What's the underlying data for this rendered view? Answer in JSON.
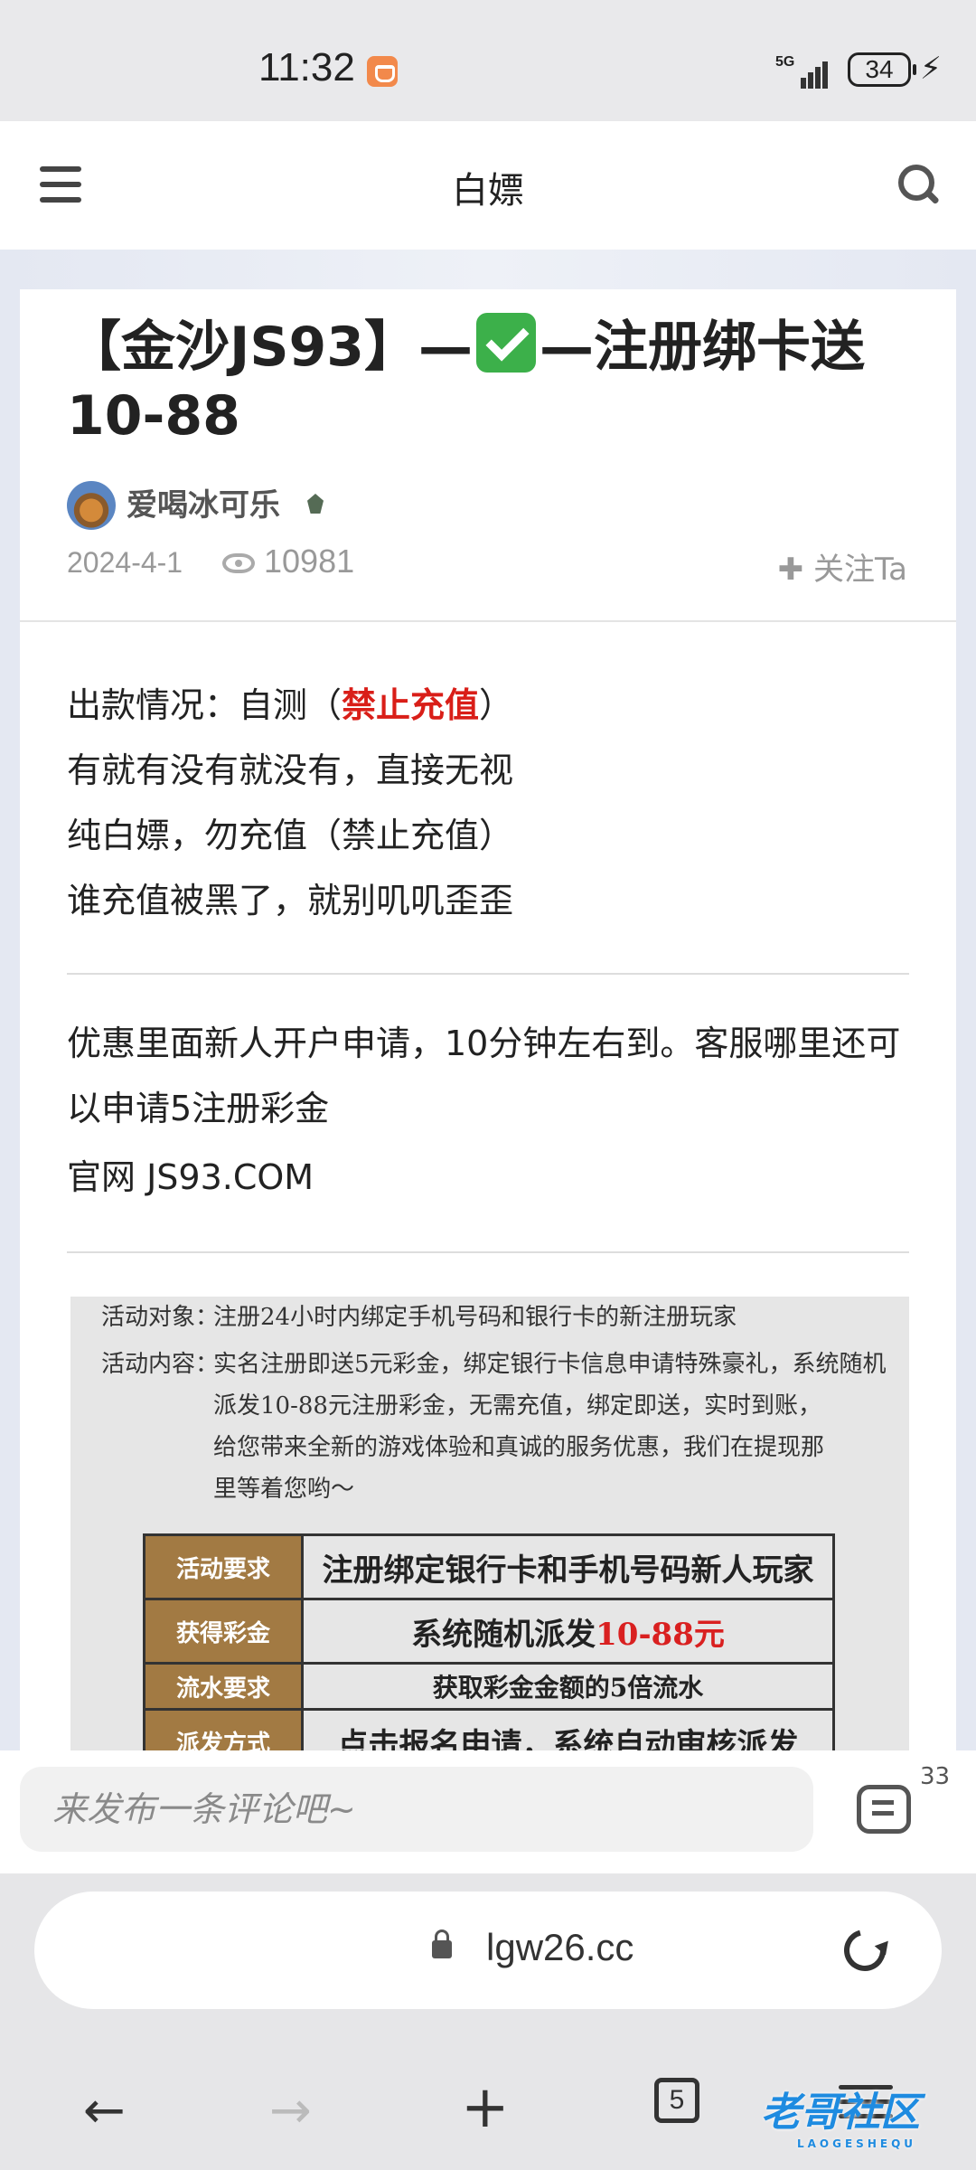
{
  "status_bar": {
    "time": "11:32",
    "network": "5G",
    "battery": "34"
  },
  "app_bar": {
    "title": "白嫖"
  },
  "post": {
    "title_part1": "【金沙JS93】—",
    "title_part2": "—注册绑卡送10-88",
    "author": "爱喝冰可乐",
    "date": "2024-4-1",
    "views": "10981",
    "follow_label": "关注Ta",
    "line1_prefix": "出款情况：自测（",
    "line1_red": "禁止充值",
    "line1_suffix": "）",
    "line2": "有就有没有就没有，直接无视",
    "line3": "纯白嫖，勿充值（禁止充值）",
    "line4": "谁充值被黑了，就别叽叽歪歪",
    "para2": "优惠里面新人开户申请，10分钟左右到。客服哪里还可以申请5注册彩金",
    "site": "官网 JS93.COM"
  },
  "poster": {
    "target_label": "活动对象：",
    "target_text": "注册24小时内绑定手机号码和银行卡的新注册玩家",
    "content_label": "活动内容：",
    "content_line1": "实名注册即送5元彩金，绑定银行卡信息申请特殊豪礼，系统随机",
    "content_line2": "派发10-88元注册彩金，无需充值，绑定即送，实时到账，",
    "content_line3": "给您带来全新的游戏体验和真诚的服务优惠，我们在提现那",
    "content_line4": "里等着您哟～",
    "rows": [
      {
        "label": "活动要求",
        "value": "注册绑定银行卡和手机号码新人玩家"
      },
      {
        "label": "获得彩金",
        "value_prefix": "系统随机派发",
        "value_highlight": "10-88元"
      },
      {
        "label": "流水要求",
        "value": "获取彩金金额的5倍流水"
      },
      {
        "label": "派发方式",
        "value": "点击报名申请，系统自动审核派发"
      }
    ]
  },
  "comment_bar": {
    "placeholder": "来发布一条评论吧~",
    "count": "33"
  },
  "browser": {
    "url": "lgw26.cc",
    "tab_count": "5"
  },
  "watermark": {
    "text": "老哥社区",
    "sub": "LAOGESHEQU"
  }
}
